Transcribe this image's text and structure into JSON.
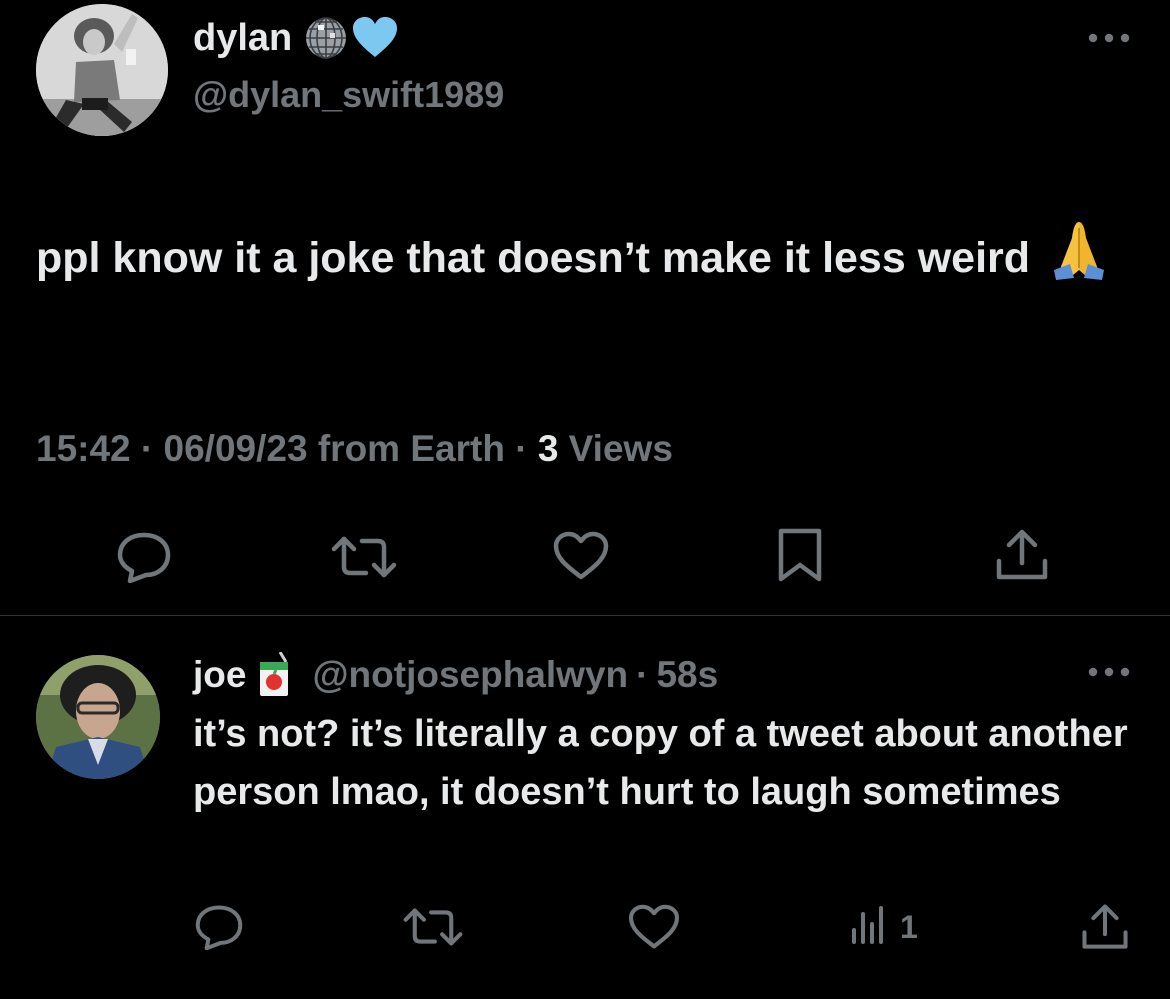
{
  "main_tweet": {
    "display_name": "dylan",
    "name_emojis": [
      "disco-ball-icon",
      "light-blue-heart-icon"
    ],
    "handle": "@dylan_swift1989",
    "text": "ppl know it a joke that doesn’t make it less weird",
    "text_emoji": "folded-hands-icon",
    "time": "15:42",
    "separator": "·",
    "date": "06/09/23",
    "source": "from Earth",
    "views_count": "3",
    "views_label": "Views",
    "actions": [
      "reply-icon",
      "retweet-icon",
      "like-icon",
      "bookmark-icon",
      "share-icon"
    ]
  },
  "reply_tweet": {
    "display_name": "joe",
    "name_emoji": "juice-box-icon",
    "handle": "@notjosephalwyn",
    "separator": "·",
    "age": "58s",
    "text": "it’s not? it’s literally a copy of a tweet about another person lmao, it doesn’t hurt to laugh sometimes",
    "views_count": "1",
    "actions": [
      "reply-icon",
      "retweet-icon",
      "like-icon",
      "views-icon",
      "share-icon"
    ]
  },
  "colors": {
    "background": "#000000",
    "text_primary": "#e7e9ea",
    "text_muted": "#71767b",
    "divider": "#2f3336"
  }
}
